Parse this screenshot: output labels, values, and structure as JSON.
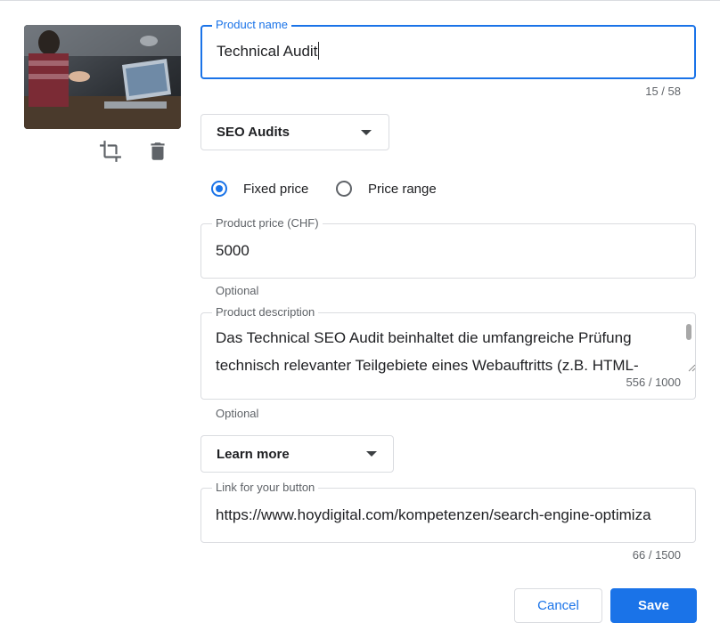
{
  "product_name": {
    "label": "Product name",
    "value": "Technical Audit",
    "counter": "15 / 58"
  },
  "category_select": {
    "value": "SEO Audits"
  },
  "price_type": {
    "options": [
      "Fixed price",
      "Price range"
    ],
    "selected": "Fixed price"
  },
  "product_price": {
    "label": "Product price (CHF)",
    "value": "5000",
    "helper": "Optional"
  },
  "product_description": {
    "label": "Product description",
    "value": "Das Technical SEO Audit beinhaltet die umfangreiche Prüfung technisch relevanter Teilgebiete eines Webauftritts (z.B. HTML-",
    "counter": "556 / 1000",
    "helper": "Optional"
  },
  "button_label_select": {
    "value": "Learn more"
  },
  "button_link": {
    "label": "Link for your button",
    "value": "https://www.hoydigital.com/kompetenzen/search-engine-optimiza",
    "counter": "66 / 1500"
  },
  "actions": {
    "cancel": "Cancel",
    "save": "Save"
  },
  "icons": {
    "crop": "crop-icon",
    "delete": "trash-icon",
    "dropdown": "caret-down-icon"
  },
  "colors": {
    "accent": "#1a73e8",
    "border": "#dadce0",
    "muted": "#5f6368"
  }
}
